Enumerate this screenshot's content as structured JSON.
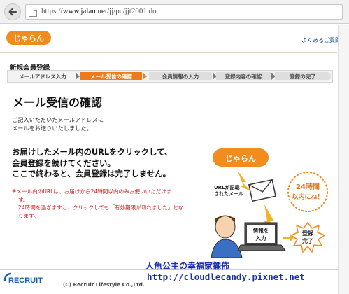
{
  "browser": {
    "url_scheme": "https://",
    "url_host": "www.jalan.net",
    "url_path": "/jj/pc/jjt2001.do"
  },
  "header": {
    "logo_text": "じゃらん",
    "faq_link": "よくあるご質問"
  },
  "registration": {
    "section_title": "新規会員登録",
    "steps": [
      {
        "label": "メールアドレス入力"
      },
      {
        "label": "メール受信の確認",
        "active": true
      },
      {
        "label": "会員情報の入力"
      },
      {
        "label": "登録内容の確認"
      },
      {
        "label": "登録の完了"
      }
    ],
    "active_color": "#ee7b1a"
  },
  "main": {
    "heading": "メール受信の確認",
    "intro_line1": "ご記入いただいたメールアドレスに",
    "intro_line2": "メールをお送りいたしました。",
    "notice_line1": "お届けしたメール内のURLをクリックして、",
    "notice_line2": "会員登録を続けてください。",
    "notice_line3": "ここで終わると、会員登録は完了しません。",
    "warn_line1": "※メール内のURLは、お届けから24時間以内のみお使いいただけま",
    "warn_line2": "す。",
    "warn_line3": "24時間を過ぎますと、クリックしても「有効期限が切れました」とな",
    "warn_line4": "ります。"
  },
  "illustration": {
    "logo_text": "じゃらん",
    "mail_caption_1": "URLが記載",
    "mail_caption_2": "されたメール",
    "badge_line1": "24時間",
    "badge_line2": "以内にね！",
    "screen_line1": "情報を",
    "screen_line2": "入力",
    "done_line1": "登録",
    "done_line2": "完了",
    "accent_color": "#f28c1e"
  },
  "footer": {
    "brand": "RECRUIT",
    "copyright": "(C) Recruit Lifestyle Co.,Ltd."
  },
  "watermark": {
    "line1": "人魚公主の幸福家擺佈",
    "line2": "http://cloudlecandy.pixnet.net"
  }
}
